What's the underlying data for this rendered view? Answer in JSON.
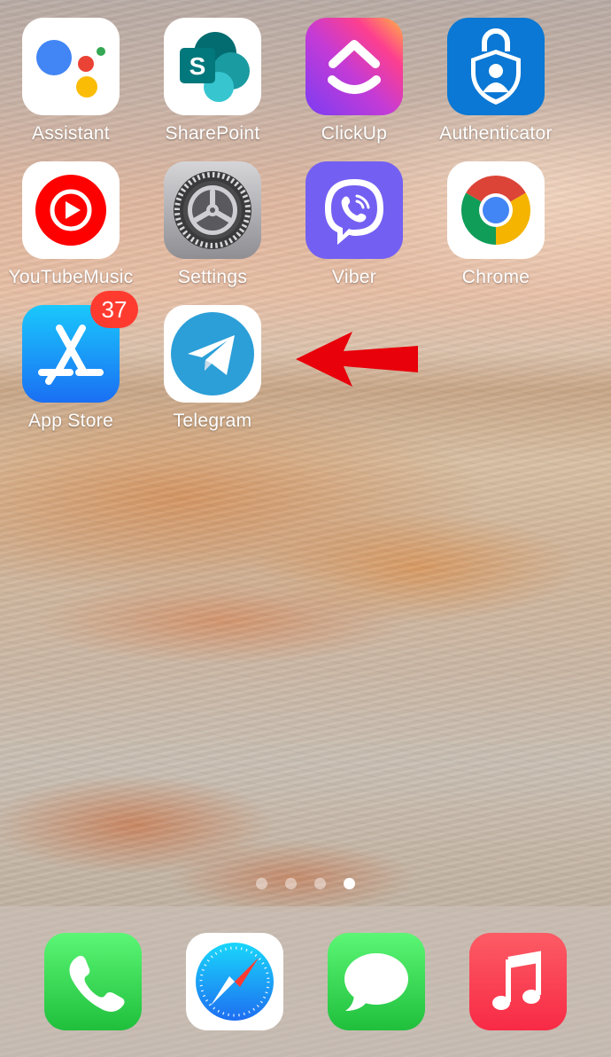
{
  "home_screen": {
    "apps": [
      {
        "id": "assistant",
        "label": "Assistant"
      },
      {
        "id": "sharepoint",
        "label": "SharePoint"
      },
      {
        "id": "clickup",
        "label": "ClickUp"
      },
      {
        "id": "authenticator",
        "label": "Authenticator"
      },
      {
        "id": "youtube-music",
        "label": "YouTubeMusic"
      },
      {
        "id": "settings",
        "label": "Settings"
      },
      {
        "id": "viber",
        "label": "Viber"
      },
      {
        "id": "chrome",
        "label": "Chrome"
      },
      {
        "id": "app-store",
        "label": "App Store",
        "badge": "37"
      },
      {
        "id": "telegram",
        "label": "Telegram"
      }
    ],
    "page_indicator": {
      "pages": 4,
      "current_page": 4
    },
    "annotation": {
      "type": "red-arrow",
      "points_to": "Telegram"
    }
  },
  "dock": {
    "apps": [
      {
        "id": "phone",
        "icon": "phone-icon"
      },
      {
        "id": "safari",
        "icon": "compass-icon"
      },
      {
        "id": "messages",
        "icon": "speech-bubble-icon"
      },
      {
        "id": "music",
        "icon": "music-note-icon"
      }
    ]
  },
  "colors": {
    "badge": "#ff3b30",
    "arrow": "#e8000b",
    "telegram_blue": "#2c9fd8",
    "dock_green": "#34c759",
    "music_red": "#fc3c44"
  }
}
